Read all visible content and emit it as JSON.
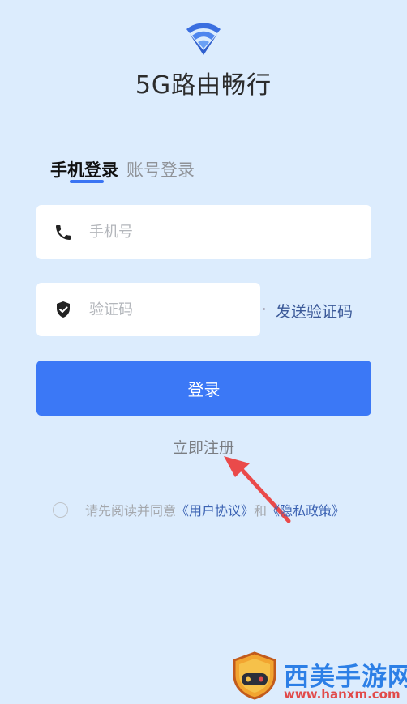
{
  "app": {
    "title": "5G路由畅行"
  },
  "tabs": [
    {
      "label": "手机登录",
      "active": true
    },
    {
      "label": "账号登录",
      "active": false
    }
  ],
  "form": {
    "phone": {
      "value": "",
      "placeholder": "手机号",
      "icon": "phone-icon"
    },
    "code": {
      "value": "",
      "placeholder": "验证码",
      "icon": "shield-check-icon"
    },
    "send_code_label": "发送验证码"
  },
  "login_label": "登录",
  "register_label": "立即注册",
  "agreement": {
    "checked": false,
    "prefix": "请先阅读并同意",
    "user_agreement": "《用户协议》",
    "conjunction": "和",
    "privacy_policy": "《隐私政策》"
  },
  "watermark": {
    "title": "西美手游网",
    "url": "www.hanxm.com"
  },
  "colors": {
    "background": "#dcecfd",
    "primary": "#3b78f6",
    "link": "#3c63b3",
    "annotation_arrow": "#ea4a4a"
  }
}
